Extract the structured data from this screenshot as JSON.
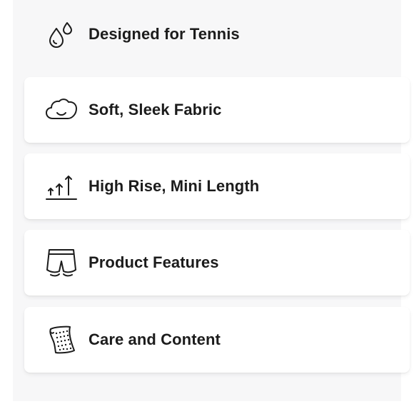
{
  "header": {
    "icon": "water-drops-icon",
    "label": "Designed for Tennis"
  },
  "cards": [
    {
      "icon": "smiling-cloud-icon",
      "label": "Soft, Sleek Fabric"
    },
    {
      "icon": "rising-arrows-icon",
      "label": "High Rise, Mini Length"
    },
    {
      "icon": "shorts-icon",
      "label": "Product Features"
    },
    {
      "icon": "care-tag-icon",
      "label": "Care and Content"
    }
  ],
  "colors": {
    "text": "#1c1c1c",
    "card_background": "#ffffff",
    "panel_background": "#f7f7f8"
  }
}
